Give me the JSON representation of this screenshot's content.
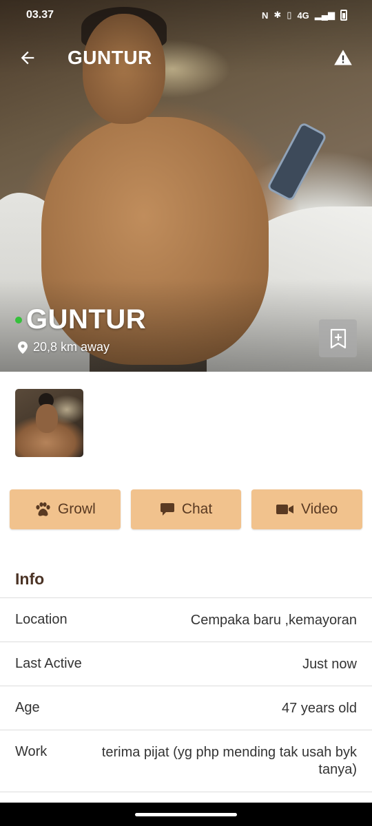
{
  "status_bar": {
    "time": "03.37",
    "network": "4G"
  },
  "app_bar": {
    "title": "GUNTUR",
    "back_icon": "arrow-left-icon",
    "report_icon": "warning-icon"
  },
  "profile": {
    "name": "GUNTUR",
    "online": true,
    "online_color": "#35c13b",
    "distance": "20,8 km away"
  },
  "actions": [
    {
      "label": "Growl",
      "icon": "paw-icon"
    },
    {
      "label": "Chat",
      "icon": "chat-bubble-icon"
    },
    {
      "label": "Video",
      "icon": "video-camera-icon"
    }
  ],
  "info": {
    "title": "Info",
    "rows": [
      {
        "label": "Location",
        "value": "Cempaka baru ,kemayoran"
      },
      {
        "label": "Last Active",
        "value": "Just now"
      },
      {
        "label": "Age",
        "value": "47 years old"
      },
      {
        "label": "Work",
        "value": "terima pijat (yg php mending tak usah byk tanya)"
      }
    ]
  },
  "colors": {
    "button_bg": "#f1c28d",
    "button_text": "#5a3a22",
    "section_title": "#4b3325"
  }
}
